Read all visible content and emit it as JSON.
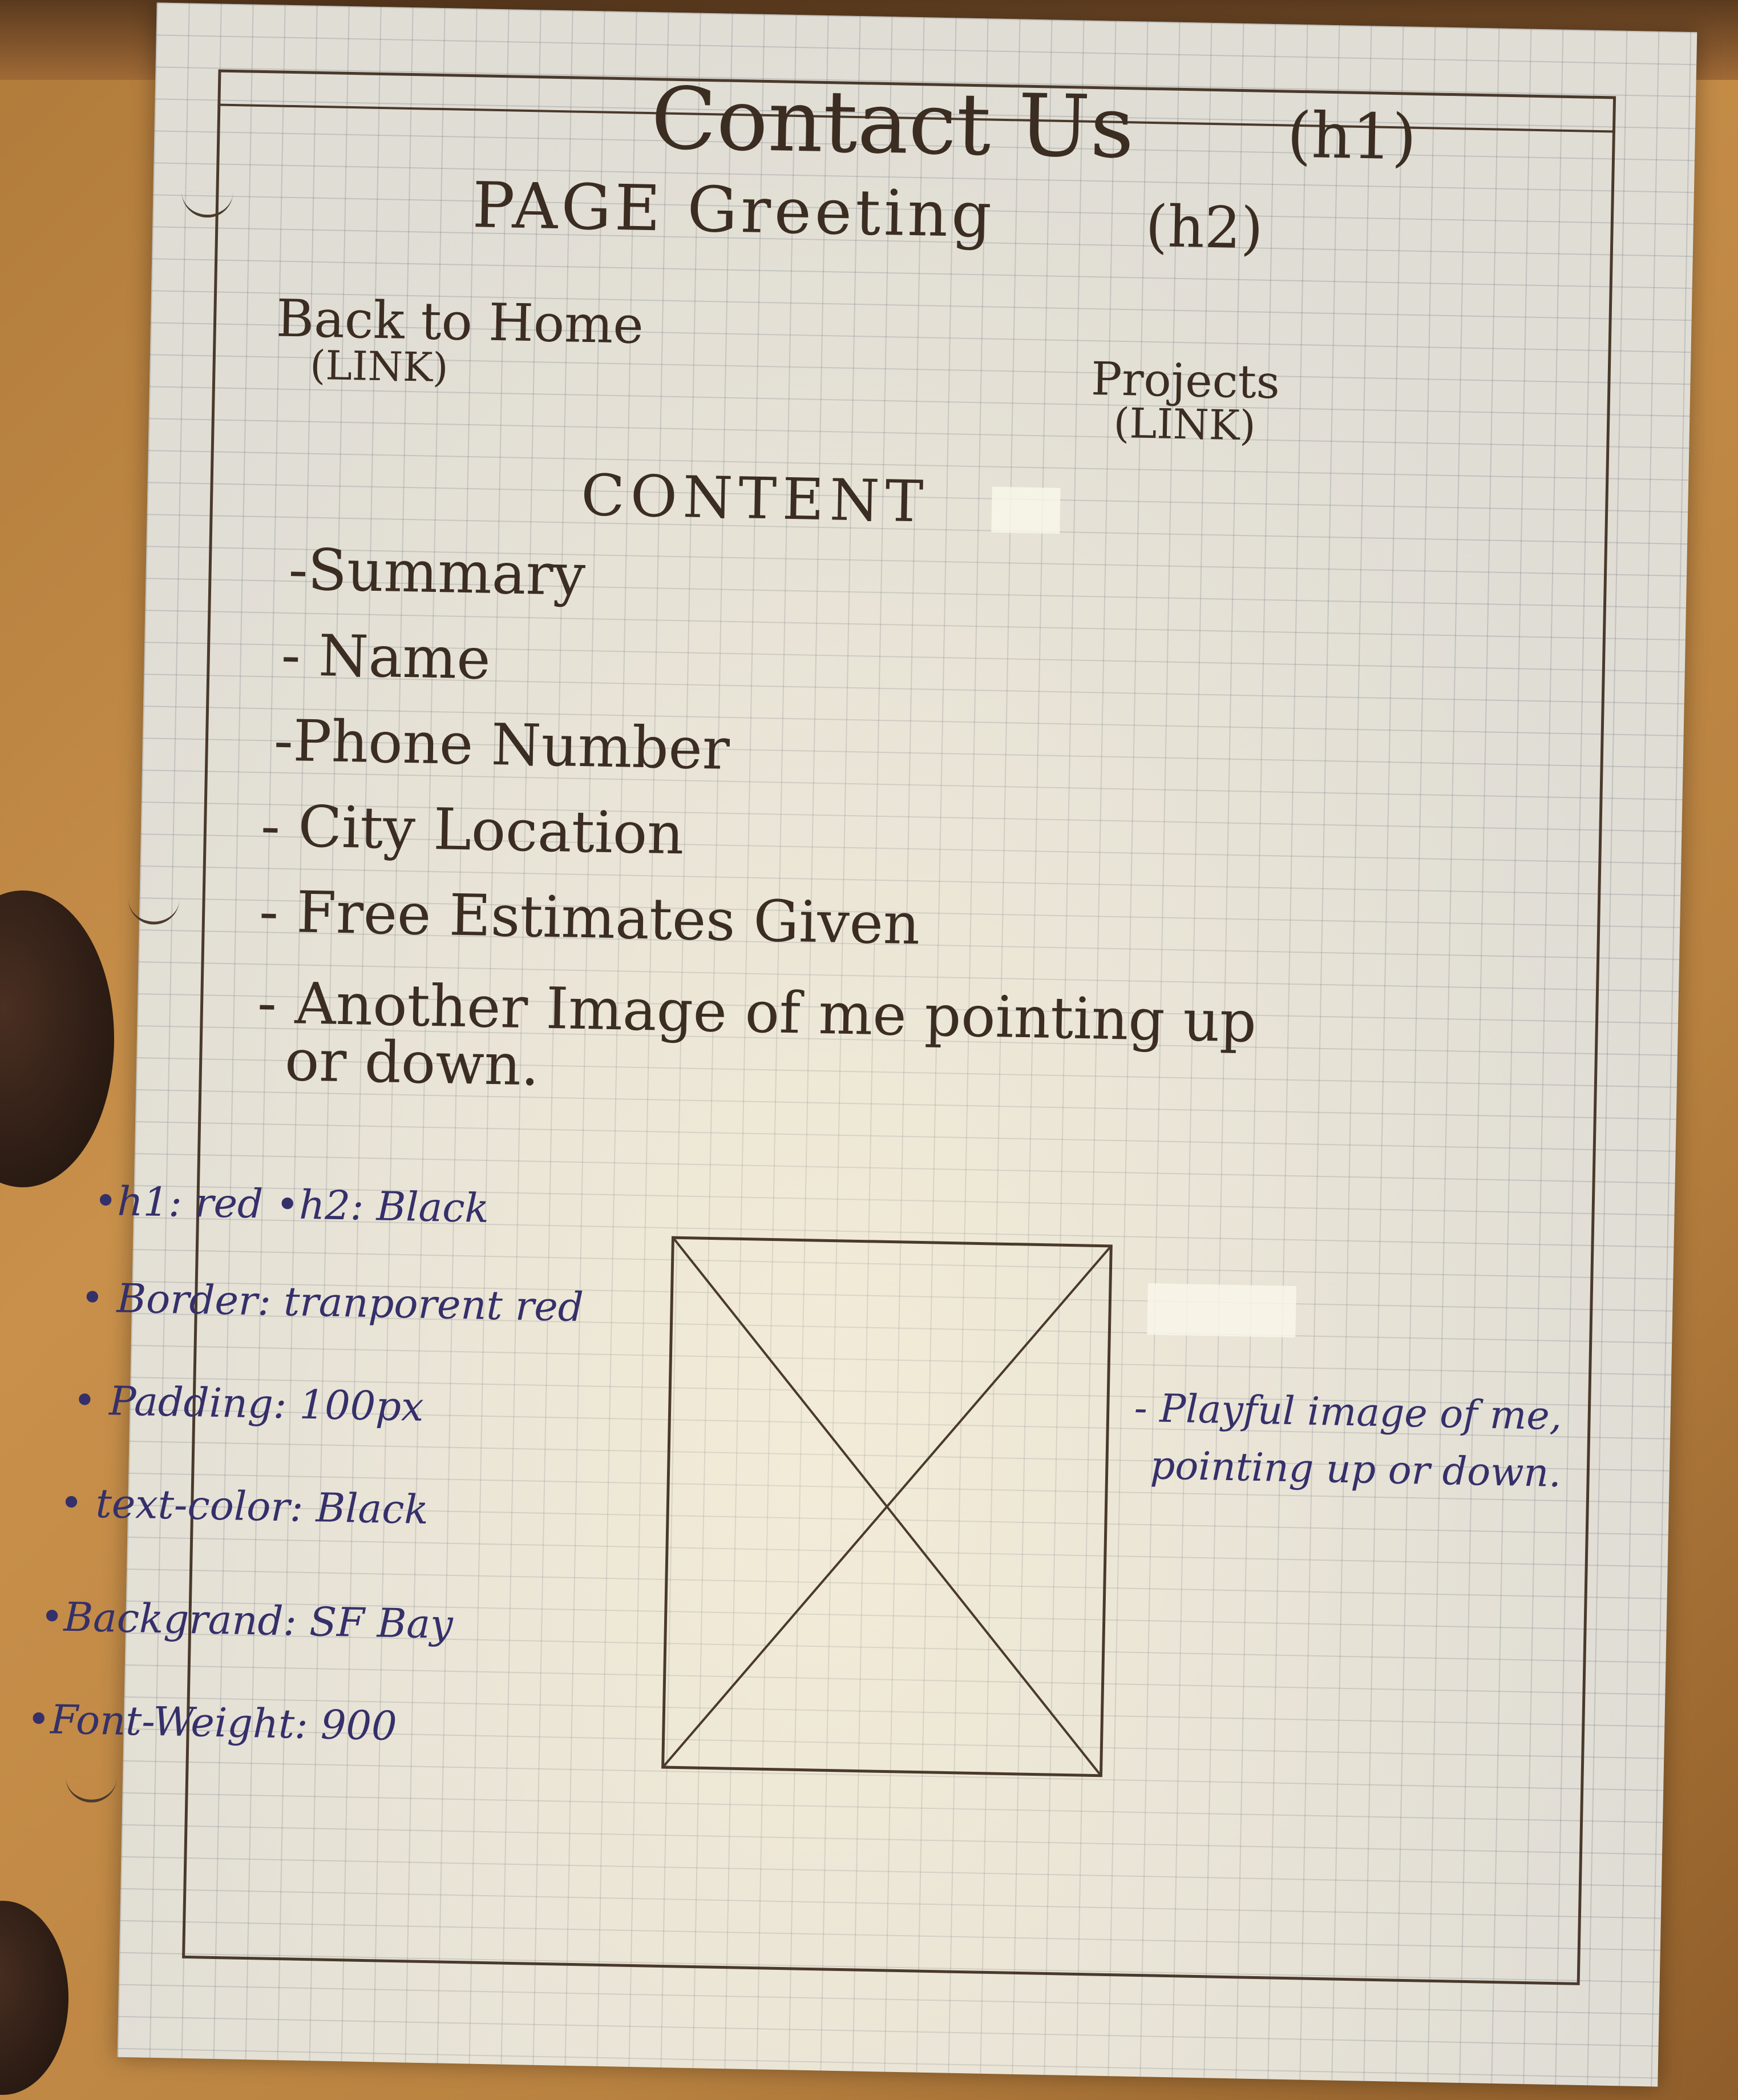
{
  "sketch": {
    "title": "Contact Us",
    "title_tag": "(h1)",
    "greeting": "PAGE Greeting",
    "greeting_tag": "(h2)",
    "nav": {
      "home_label": "Back to Home",
      "home_note": "(LINK)",
      "projects_label": "Projects",
      "projects_note": "(LINK)"
    },
    "content_heading": "CONTENT",
    "content_items": [
      "-Summary",
      "- Name",
      "-Phone Number",
      "- City Location",
      "- Free Estimates Given",
      "- Another Image of me pointing up",
      "or down."
    ],
    "style_notes": [
      "•h1: red •h2: Black",
      "• Border: tranporent red",
      "• Padding: 100px",
      "• text-color: Black",
      "•Backgrand: SF Bay",
      "•Font-Weight: 900"
    ],
    "image_caption_line1": "- Playful image of me,",
    "image_caption_line2": "pointing up or down."
  },
  "colors": {
    "pencil": "#3b2d22",
    "ink": "#35306a",
    "paper": "#ece9e0",
    "table": "#b98240"
  }
}
